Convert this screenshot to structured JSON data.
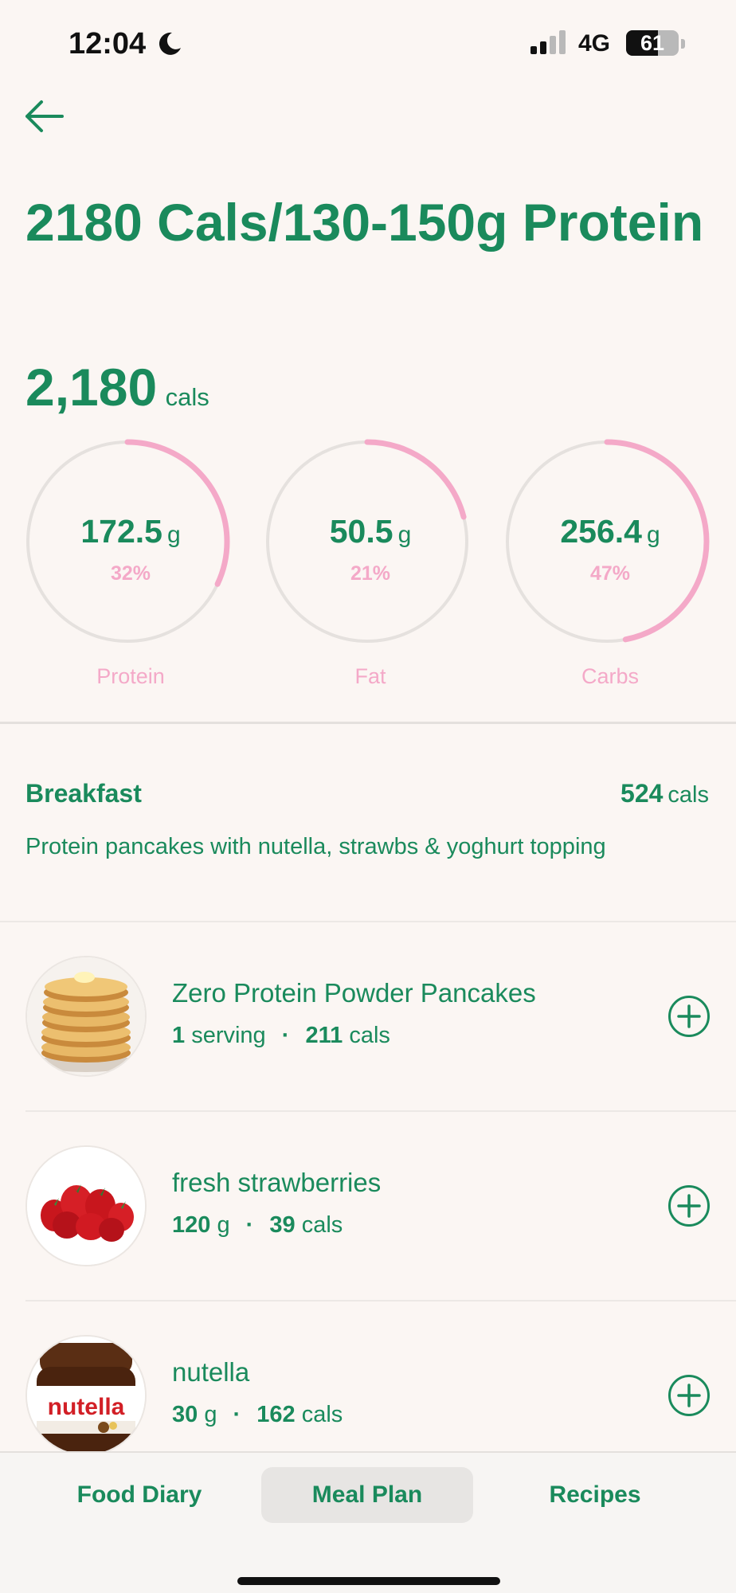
{
  "status_bar": {
    "time": "12:04",
    "network": "4G",
    "battery_percent": 61,
    "battery_label": "61"
  },
  "plan": {
    "title": "2180 Cals/130-150g Protein",
    "total_value": "2,180",
    "total_unit": "cals"
  },
  "macros": [
    {
      "name": "Protein",
      "value": "172.5",
      "unit": "g",
      "percent_label": "32%",
      "percent": 32
    },
    {
      "name": "Fat",
      "value": "50.5",
      "unit": "g",
      "percent_label": "21%",
      "percent": 21
    },
    {
      "name": "Carbs",
      "value": "256.4",
      "unit": "g",
      "percent_label": "47%",
      "percent": 47
    }
  ],
  "meal": {
    "title": "Breakfast",
    "cals_value": "524",
    "cals_unit": "cals",
    "description": "Protein pancakes with nutella, strawbs & yoghurt topping",
    "items": [
      {
        "name": "Zero Protein Powder Pancakes",
        "qty_num": "1",
        "qty_unit": "serving",
        "cals_num": "211",
        "cals_unit": "cals",
        "image": "pancakes"
      },
      {
        "name": "fresh strawberries",
        "qty_num": "120",
        "qty_unit": "g",
        "cals_num": "39",
        "cals_unit": "cals",
        "image": "strawberries"
      },
      {
        "name": "nutella",
        "qty_num": "30",
        "qty_unit": "g",
        "cals_num": "162",
        "cals_unit": "cals",
        "image": "nutella-jar",
        "image_text": "nutella"
      }
    ]
  },
  "nav": {
    "tabs": [
      {
        "label": "Food Diary",
        "active": false
      },
      {
        "label": "Meal Plan",
        "active": true
      },
      {
        "label": "Recipes",
        "active": false
      }
    ]
  },
  "colors": {
    "brand_green": "#1a8a5c",
    "macro_pink": "#f4a9c8",
    "ring_track": "#e5e1de",
    "background": "#fbf6f3"
  }
}
